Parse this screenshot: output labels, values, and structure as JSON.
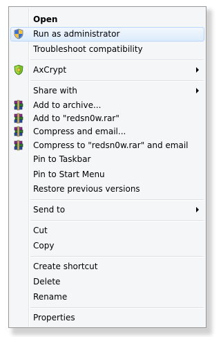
{
  "menu": {
    "items": [
      {
        "label": "Open"
      },
      {
        "label": "Run as administrator"
      },
      {
        "label": "Troubleshoot compatibility"
      },
      {
        "label": "AxCrypt"
      },
      {
        "label": "Share with"
      },
      {
        "label": "Add to archive..."
      },
      {
        "label": "Add to \"redsn0w.rar\""
      },
      {
        "label": "Compress and email..."
      },
      {
        "label": "Compress to \"redsn0w.rar\" and email"
      },
      {
        "label": "Pin to Taskbar"
      },
      {
        "label": "Pin to Start Menu"
      },
      {
        "label": "Restore previous versions"
      },
      {
        "label": "Send to"
      },
      {
        "label": "Cut"
      },
      {
        "label": "Copy"
      },
      {
        "label": "Create shortcut"
      },
      {
        "label": "Delete"
      },
      {
        "label": "Rename"
      },
      {
        "label": "Properties"
      }
    ],
    "highlighted_item": "Run as administrator"
  },
  "icons": {
    "run_as_admin": "uac-shield-icon",
    "axcrypt": "axcrypt-shield-icon",
    "winrar": "winrar-books-icon"
  },
  "colors": {
    "menu_background": "#f5f6f7",
    "highlight_border": "#b8d6fb",
    "highlight_fill": "#dcebfc"
  }
}
